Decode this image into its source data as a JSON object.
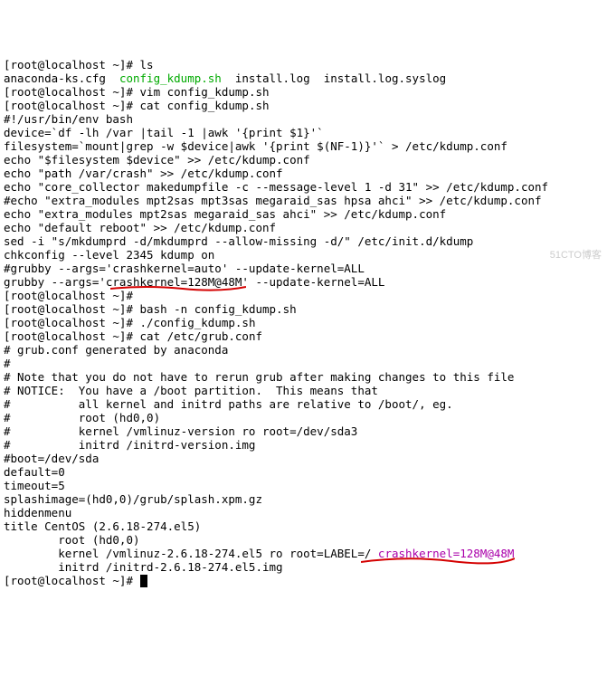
{
  "prompt": "[root@localhost ~]#",
  "prompt_short": "[root@localhost ~]#",
  "cmd_ls": "ls",
  "ls_out": {
    "a": "anaconda-ks.cfg  ",
    "b": "config_kdump.sh",
    "c": "  install.log  install.log.syslog"
  },
  "cmd_vim": "vim config_kdump.sh",
  "cmd_cat1": "cat config_kdump.sh",
  "sh1": "#!/usr/bin/env bash",
  "sh2": "device=`df -lh /var |tail -1 |awk '{print $1}'`",
  "sh3": "filesystem=`mount|grep -w $device|awk '{print $(NF-1)}'` > /etc/kdump.conf",
  "sh4": "echo \"$filesystem $device\" >> /etc/kdump.conf",
  "sh5": "echo \"path /var/crash\" >> /etc/kdump.conf",
  "sh6": "echo \"core_collector makedumpfile -c --message-level 1 -d 31\" >> /etc/kdump.conf",
  "sh7": "",
  "sh8": "#echo \"extra_modules mpt2sas mpt3sas megaraid_sas hpsa ahci\" >> /etc/kdump.conf",
  "sh9": "echo \"extra_modules mpt2sas megaraid_sas ahci\" >> /etc/kdump.conf",
  "sh10": "echo \"default reboot\" >> /etc/kdump.conf",
  "sh11": "sed -i \"s/mkdumprd -d/mkdumprd --allow-missing -d/\" /etc/init.d/kdump",
  "sh12": "chkconfig --level 2345 kdump on",
  "sh13": "#grubby --args='crashkernel=auto' --update-kernel=ALL",
  "sh14": "grubby --args='crashkernel=128M@48M' --update-kernel=ALL",
  "cmd_bash": "bash -n config_kdump.sh",
  "cmd_run": "./config_kdump.sh",
  "cmd_cat2": "cat /etc/grub.conf",
  "g1": "# grub.conf generated by anaconda",
  "g2": "#",
  "g3": "# Note that you do not have to rerun grub after making changes to this file",
  "g4": "# NOTICE:  You have a /boot partition.  This means that",
  "g5": "#          all kernel and initrd paths are relative to /boot/, eg.",
  "g6": "#          root (hd0,0)",
  "g7": "#          kernel /vmlinuz-version ro root=/dev/sda3",
  "g8": "#          initrd /initrd-version.img",
  "g9": "#boot=/dev/sda",
  "g10": "default=0",
  "g11": "timeout=5",
  "g12": "splashimage=(hd0,0)/grub/splash.xpm.gz",
  "g13": "hiddenmenu",
  "g14": "title CentOS (2.6.18-274.el5)",
  "g15": "        root (hd0,0)",
  "g16_a": "        kernel /vmlinuz-2.6.18-274.el5 ro root=LABEL=/ ",
  "g16_b": "crashkernel=128M@48M",
  "g17": "        initrd /initrd-2.6.18-274.el5.img",
  "watermark": "51CTO博客"
}
